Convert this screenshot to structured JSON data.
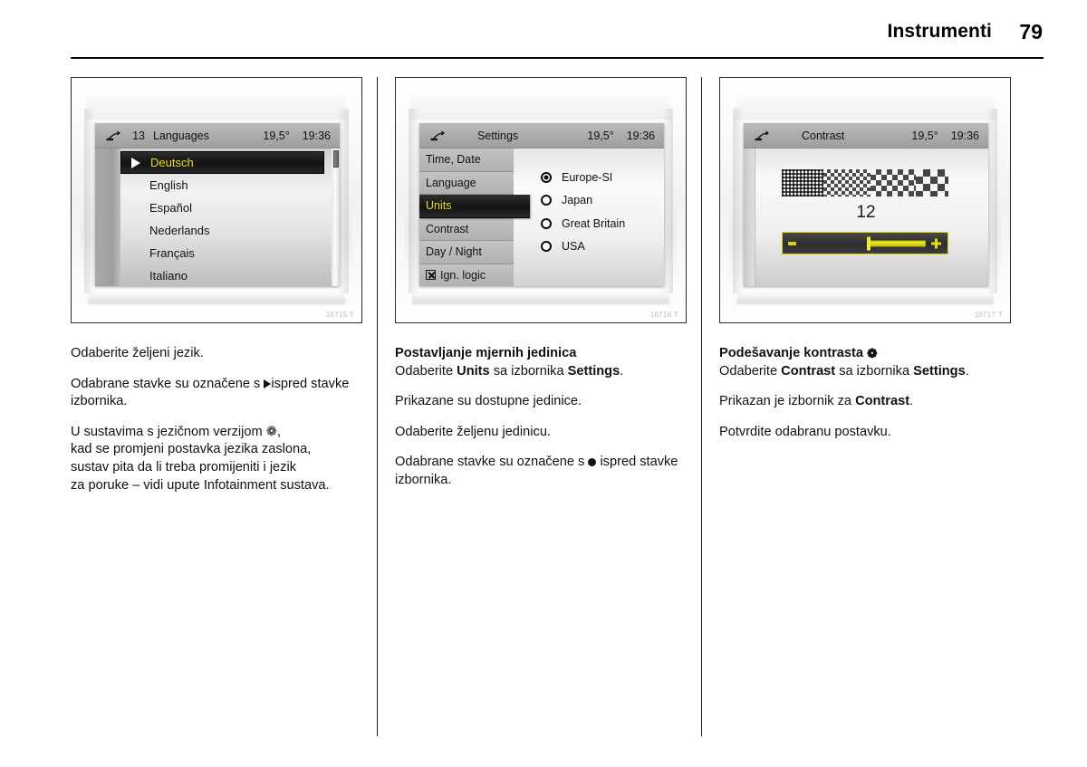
{
  "header": {
    "chapter_title": "Instrumenti",
    "page_number": "79"
  },
  "colors": {
    "selection_text": "#e9e000",
    "selection_bg": "#131313",
    "lcd_bg": "#d3d3d3",
    "titlebar_bg": "#ababab",
    "slider_accent": "#e4e000",
    "page_text": "#111111"
  },
  "figures": [
    {
      "name": "languages-screen",
      "code": "16715 T",
      "titlebar": {
        "icon": "settings-wrench-icon",
        "index": "13",
        "title": "Languages",
        "temperature": "19,5°",
        "time": "19:36"
      },
      "list": [
        {
          "label": "Deutsch",
          "selected": true
        },
        {
          "label": "English",
          "selected": false
        },
        {
          "label": "Español",
          "selected": false
        },
        {
          "label": "Nederlands",
          "selected": false
        },
        {
          "label": "Français",
          "selected": false
        },
        {
          "label": "Italiano",
          "selected": false
        }
      ]
    },
    {
      "name": "settings-units-screen",
      "code": "16716 T",
      "titlebar": {
        "icon": "settings-wrench-icon",
        "index": "",
        "title": "Settings",
        "temperature": "19,5°",
        "time": "19:36"
      },
      "menu": [
        {
          "label": "Time, Date",
          "selected": false,
          "checkbox": false
        },
        {
          "label": "Language",
          "selected": false,
          "checkbox": false
        },
        {
          "label": "Units",
          "selected": true,
          "checkbox": false
        },
        {
          "label": "Contrast",
          "selected": false,
          "checkbox": false
        },
        {
          "label": "Day / Night",
          "selected": false,
          "checkbox": false
        },
        {
          "label": "Ign. logic",
          "selected": false,
          "checkbox": true
        }
      ],
      "options": [
        {
          "label": "Europe-SI",
          "selected": true
        },
        {
          "label": "Japan",
          "selected": false
        },
        {
          "label": "Great Britain",
          "selected": false
        },
        {
          "label": "USA",
          "selected": false
        }
      ]
    },
    {
      "name": "contrast-screen",
      "code": "16717 T",
      "titlebar": {
        "icon": "settings-wrench-icon",
        "index": "",
        "title": "Contrast",
        "temperature": "19,5°",
        "time": "19:36"
      },
      "contrast_value": "12"
    }
  ],
  "columns": [
    {
      "paragraphs": [
        {
          "type": "text",
          "text": "Odaberite željeni jezik."
        },
        {
          "type": "marker_triangle",
          "before": "Odabrane stavke su označene s",
          "after": "ispred stavke izbornika."
        },
        {
          "type": "lines",
          "lines": [
            "U sustavima s jezičnom verzijom ❁,",
            "kad se promjeni postavka jezika zaslona,",
            "sustav pita da li treba promijeniti i jezik",
            "za poruke – vidi upute Infotainment sustava."
          ]
        }
      ]
    },
    {
      "heading": "Postavljanje mjernih jedinica",
      "heading_suffix": "",
      "lead": {
        "pre": "Odaberite ",
        "bold1": "Units",
        "mid": " sa izbornika ",
        "bold2": "Settings",
        "post": "."
      },
      "paragraphs": [
        {
          "type": "text",
          "text": "Prikazane su dostupne jedinice."
        },
        {
          "type": "text",
          "text": "Odaberite željenu jedinicu."
        },
        {
          "type": "marker_dot",
          "before": "Odabrane stavke su označene s",
          "after": "ispred stavke izbornika."
        }
      ]
    },
    {
      "heading": "Podešavanje kontrasta",
      "heading_suffix": "❁",
      "lead": {
        "pre": "Odaberite ",
        "bold1": "Contrast",
        "mid": " sa izbornika ",
        "bold2": "Settings",
        "post": "."
      },
      "paragraphs": [
        {
          "type": "rich",
          "pre": "Prikazan je izbornik za ",
          "bold": "Contrast",
          "post": "."
        },
        {
          "type": "text",
          "text": "Potvrdite odabranu postavku."
        }
      ]
    }
  ]
}
